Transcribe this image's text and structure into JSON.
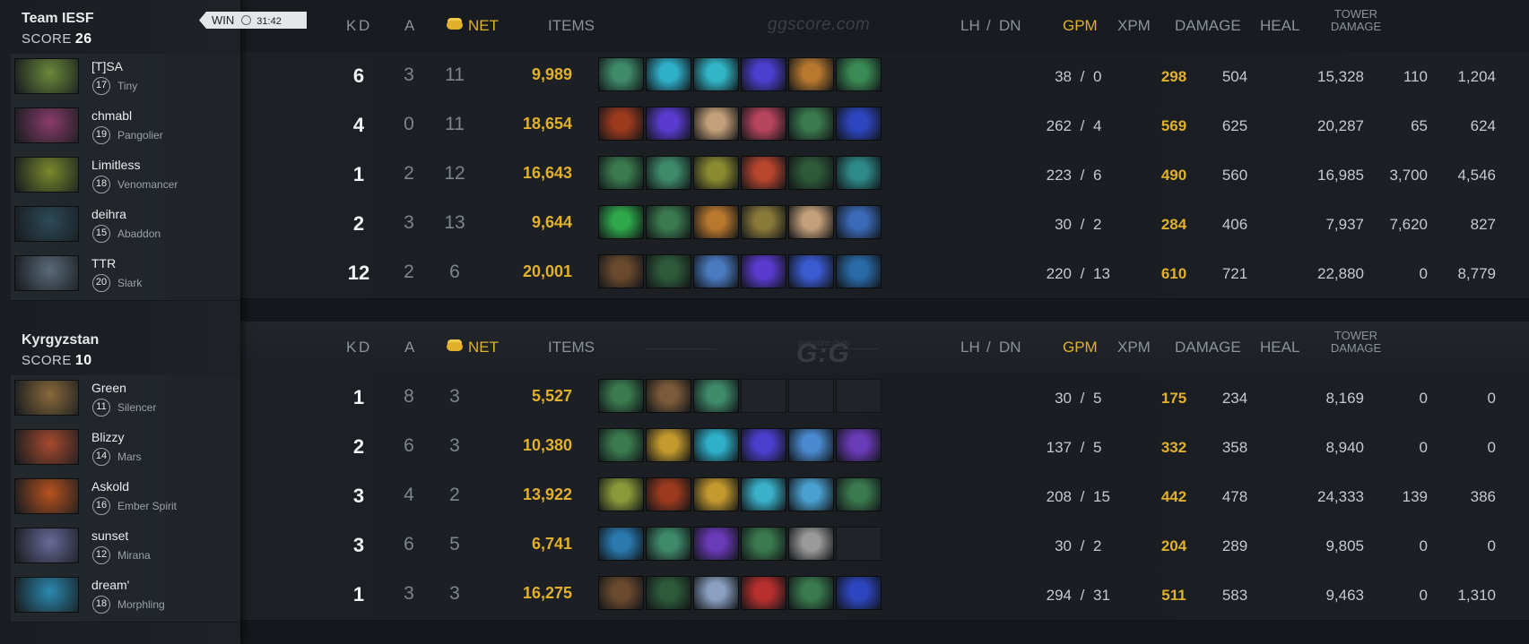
{
  "teams": [
    {
      "name": "Team IESF",
      "score_label": "SCORE",
      "score": "26",
      "result": "WIN",
      "duration": "31:42",
      "players": [
        {
          "name": "[T]SA",
          "level": "17",
          "hero": "Tiny",
          "portrait_color": "#6b8a3a",
          "k": "6",
          "d": "3",
          "a": "11",
          "net": "9,989",
          "lh": "38",
          "dn": "0",
          "gpm": "298",
          "xpm": "504",
          "damage": "15,328",
          "heal": "110",
          "tower": "1,204",
          "items": [
            "#3f8a6a",
            "#2fb0c9",
            "#32b6c7",
            "#4c3fd0",
            "#b8782e",
            "#3a8a54"
          ]
        },
        {
          "name": "chmabl",
          "level": "19",
          "hero": "Pangolier",
          "portrait_color": "#8a3c6c",
          "k": "4",
          "d": "0",
          "a": "11",
          "net": "18,654",
          "lh": "262",
          "dn": "4",
          "gpm": "569",
          "xpm": "625",
          "damage": "20,287",
          "heal": "65",
          "tower": "624",
          "items": [
            "#9c3a1e",
            "#5a3bd0",
            "#c4a07a",
            "#b8455e",
            "#3a7a4e",
            "#2d46c0"
          ]
        },
        {
          "name": "Limitless",
          "level": "18",
          "hero": "Venomancer",
          "portrait_color": "#7a8a2c",
          "k": "1",
          "d": "2",
          "a": "12",
          "net": "16,643",
          "lh": "223",
          "dn": "6",
          "gpm": "490",
          "xpm": "560",
          "damage": "16,985",
          "heal": "3,700",
          "tower": "4,546",
          "items": [
            "#3a7a4e",
            "#3f8a6a",
            "#8a8a30",
            "#b8452e",
            "#2e5a3a",
            "#2e8a88"
          ]
        },
        {
          "name": "deihra",
          "level": "15",
          "hero": "Abaddon",
          "portrait_color": "#2c4a5a",
          "k": "2",
          "d": "3",
          "a": "13",
          "net": "9,644",
          "lh": "30",
          "dn": "2",
          "gpm": "284",
          "xpm": "406",
          "damage": "7,937",
          "heal": "7,620",
          "tower": "827",
          "items": [
            "#2ea84a",
            "#3a7a4e",
            "#b8782e",
            "#8a7a3a",
            "#c4a07a",
            "#3a6ab8"
          ]
        },
        {
          "name": "TTR",
          "level": "20",
          "hero": "Slark",
          "portrait_color": "#5a6a7a",
          "k": "12",
          "d": "2",
          "a": "6",
          "net": "20,001",
          "lh": "220",
          "dn": "13",
          "gpm": "610",
          "xpm": "721",
          "damage": "22,880",
          "heal": "0",
          "tower": "8,779",
          "items": [
            "#6a4a2e",
            "#2e5a3a",
            "#4a7ac0",
            "#5a3bd0",
            "#3a5ad0",
            "#2a6aa8"
          ]
        }
      ]
    },
    {
      "name": "Kyrgyzstan",
      "score_label": "SCORE",
      "score": "10",
      "players": [
        {
          "name": "Green",
          "level": "11",
          "hero": "Silencer",
          "portrait_color": "#8a6a3a",
          "k": "1",
          "d": "8",
          "a": "3",
          "net": "5,527",
          "lh": "30",
          "dn": "5",
          "gpm": "175",
          "xpm": "234",
          "damage": "8,169",
          "heal": "0",
          "tower": "0",
          "items": [
            "#3a7a4e",
            "#7a5a3a",
            "#3f8a6a",
            "",
            "",
            ""
          ]
        },
        {
          "name": "Blizzy",
          "level": "14",
          "hero": "Mars",
          "portrait_color": "#a84a2e",
          "k": "2",
          "d": "6",
          "a": "3",
          "net": "10,380",
          "lh": "137",
          "dn": "5",
          "gpm": "332",
          "xpm": "358",
          "damage": "8,940",
          "heal": "0",
          "tower": "0",
          "items": [
            "#3a7a4e",
            "#c49a2e",
            "#2fb0c9",
            "#4c3fd0",
            "#4a8ad0",
            "#6a3ab8"
          ]
        },
        {
          "name": "Askold",
          "level": "16",
          "hero": "Ember Spirit",
          "portrait_color": "#b8521e",
          "k": "3",
          "d": "4",
          "a": "2",
          "net": "13,922",
          "lh": "208",
          "dn": "15",
          "gpm": "442",
          "xpm": "478",
          "damage": "24,333",
          "heal": "139",
          "tower": "386",
          "items": [
            "#8a9a3a",
            "#9c3a1e",
            "#c49a2e",
            "#3ab0c9",
            "#4aa0d0",
            "#3a7a4e"
          ]
        },
        {
          "name": "sunset",
          "level": "12",
          "hero": "Mirana",
          "portrait_color": "#6a6a9a",
          "k": "3",
          "d": "6",
          "a": "5",
          "net": "6,741",
          "lh": "30",
          "dn": "2",
          "gpm": "204",
          "xpm": "289",
          "damage": "9,805",
          "heal": "0",
          "tower": "0",
          "items": [
            "#2a7ab0",
            "#3f8a6a",
            "#6a3ab8",
            "#3a7a4e",
            "#9a9a9a",
            ""
          ]
        },
        {
          "name": "dream'",
          "level": "18",
          "hero": "Morphling",
          "portrait_color": "#2a8ab0",
          "k": "1",
          "d": "3",
          "a": "3",
          "net": "16,275",
          "lh": "294",
          "dn": "31",
          "gpm": "511",
          "xpm": "583",
          "damage": "9,463",
          "heal": "0",
          "tower": "1,310",
          "items": [
            "#6a4a2e",
            "#2e5a3a",
            "#8aa0c0",
            "#b8302e",
            "#3a7a4e",
            "#2d46c0"
          ]
        }
      ]
    }
  ],
  "columns": {
    "k": "K",
    "d": "D",
    "a": "A",
    "net": "NET",
    "items": "ITEMS",
    "lh": "LH",
    "slash": "/",
    "dn": "DN",
    "gpm": "GPM",
    "xpm": "XPM",
    "damage": "DAMAGE",
    "heal": "HEAL",
    "tower_1": "TOWER",
    "tower_2": "DAMAGE"
  },
  "watermark": "ggscore.com",
  "logo": {
    "text": "G:G",
    "sub": "ggscore.com"
  }
}
